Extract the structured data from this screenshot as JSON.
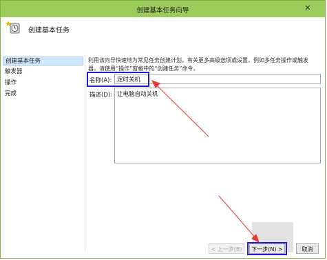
{
  "window": {
    "title": "创建基本任务向导",
    "close_label": "✕"
  },
  "header": {
    "title": "创建基本任务"
  },
  "sidebar": {
    "items": [
      {
        "label": "创建基本任务"
      },
      {
        "label": "触发器"
      },
      {
        "label": "操作"
      },
      {
        "label": "完成"
      }
    ]
  },
  "content": {
    "intro_line1": "利用该向导快速地为常见任务创建计划。有关更多高级选项或设置，例如多任务操作或触发",
    "intro_line2": "器，请使用“操作”窗格中的“创建任务”命令。",
    "name_label": "名称(A):",
    "name_value": "定时关机",
    "desc_label": "描述(D):",
    "desc_value": "让电脑自动关机"
  },
  "footer": {
    "back": "< 上一步(B)",
    "next": "下一步(N) >",
    "cancel": "取消"
  },
  "colors": {
    "titlebar": "#9ccc5b",
    "highlight": "#1c1ce0",
    "arrow": "#e53935",
    "selection": "#cfe6ff"
  }
}
